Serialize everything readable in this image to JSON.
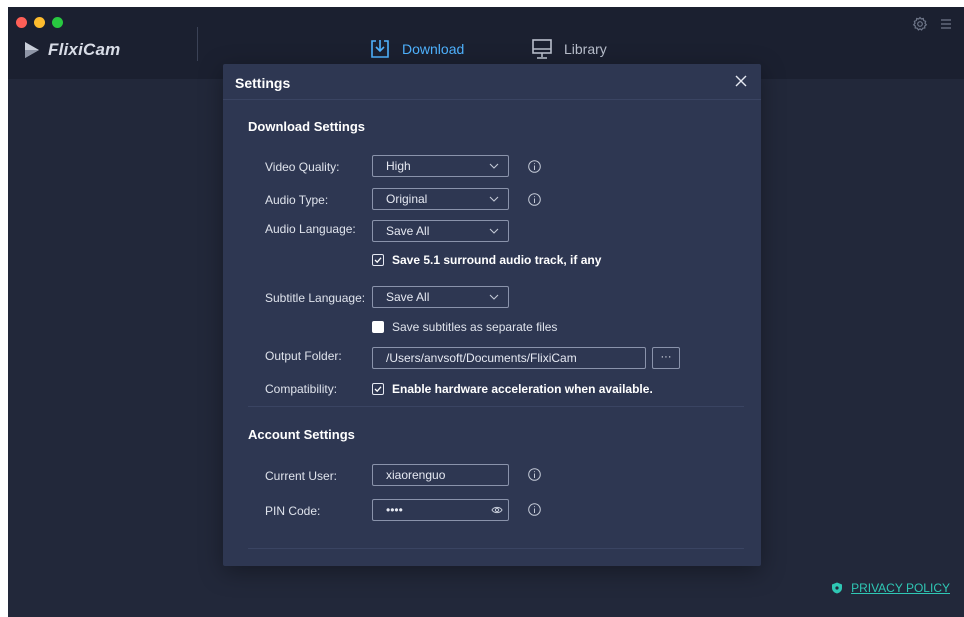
{
  "app": {
    "name": "FlixiCam"
  },
  "nav": {
    "download": "Download",
    "library": "Library"
  },
  "footer": {
    "privacy": "PRIVACY POLICY"
  },
  "colors": {
    "accent": "#4fb3ff",
    "teal": "#2fc7b4",
    "modal_bg": "#2e3752",
    "window_bg": "#22283a"
  },
  "settings": {
    "title": "Settings",
    "download_section": "Download Settings",
    "video_quality": {
      "label": "Video Quality:",
      "value": "High"
    },
    "audio_type": {
      "label": "Audio Type:",
      "value": "Original"
    },
    "audio_language": {
      "label": "Audio Language:",
      "value": "Save All"
    },
    "surround": {
      "label": "Save 5.1 surround audio track, if any",
      "checked": true
    },
    "subtitle_language": {
      "label": "Subtitle Language:",
      "value": "Save All"
    },
    "subtitles_separate": {
      "label": "Save subtitles as separate files",
      "checked": false
    },
    "output_folder": {
      "label": "Output Folder:",
      "value": "/Users/anvsoft/Documents/FlixiCam",
      "browse": "···"
    },
    "compatibility": {
      "label": "Compatibility:",
      "option": "Enable hardware acceleration when available.",
      "checked": true
    },
    "account_section": "Account Settings",
    "current_user": {
      "label": "Current User:",
      "value": "xiaorenguo"
    },
    "pin_code": {
      "label": "PIN Code:",
      "value": "••••"
    }
  }
}
